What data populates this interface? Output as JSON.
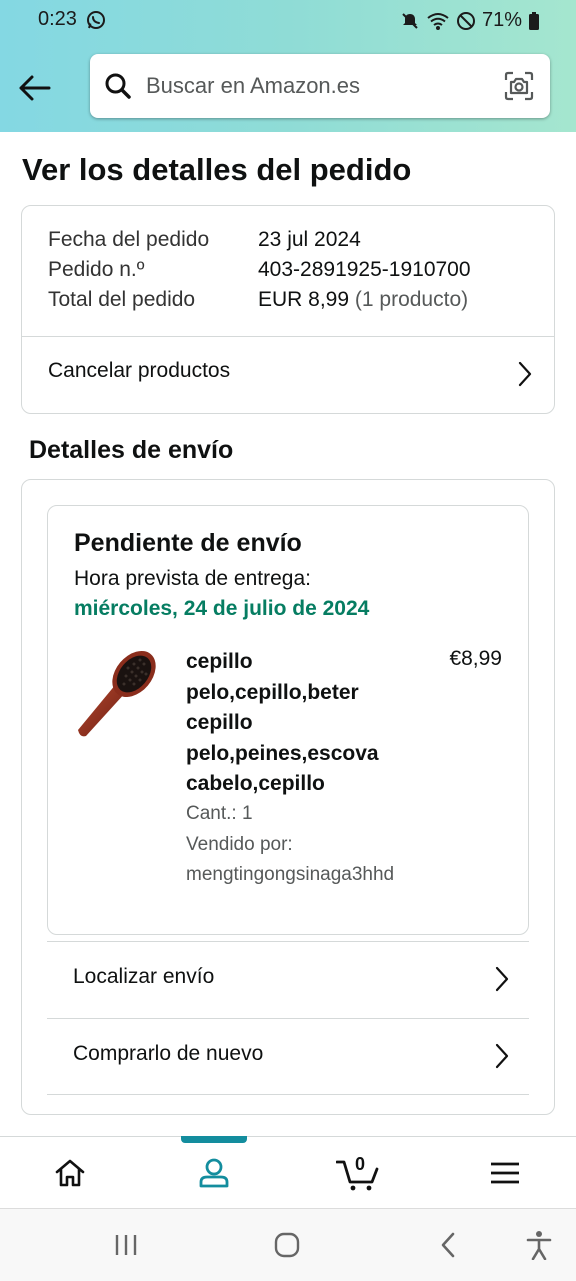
{
  "status_bar": {
    "time": "0:23",
    "battery": "71%",
    "icons": [
      "whatsapp-icon",
      "mute-icon",
      "wifi-icon",
      "do-not-disturb-icon",
      "battery-icon"
    ]
  },
  "header": {
    "search_placeholder": "Buscar en Amazon.es",
    "icons": [
      "back-arrow-icon",
      "search-icon",
      "camera-icon"
    ]
  },
  "page_title": "Ver los detalles del pedido",
  "order_summary": {
    "rows": [
      {
        "label": "Fecha del pedido",
        "value": "23 jul 2024"
      },
      {
        "label": "Pedido n.º",
        "value": "403-2891925-1910700"
      },
      {
        "label": "Total del pedido",
        "value": "EUR 8,99",
        "sub": "(1 producto)"
      }
    ],
    "cancel_label": "Cancelar productos"
  },
  "shipping": {
    "section_title": "Detalles de envío",
    "status": "Pendiente de envío",
    "eta_label": "Hora prevista de entrega:",
    "eta_date": "miércoles, 24 de julio de 2024",
    "product": {
      "name": "cepillo pelo,cepillo,beter cepillo pelo,peines,escova cabelo,cepillo",
      "price": "€8,99",
      "qty": "Cant.: 1",
      "sold_by_label": "Vendido por:",
      "seller": "mengtingongsinaga3hhd"
    },
    "actions": [
      {
        "label": "Localizar envío"
      },
      {
        "label": "Comprarlo de nuevo"
      }
    ]
  },
  "bottom_nav": {
    "items": [
      "home-icon",
      "account-icon",
      "cart-icon",
      "menu-icon"
    ],
    "active": "account-icon",
    "cart_count": "0",
    "accent_color": "#138d9e"
  },
  "system_nav": [
    "recent-apps-icon",
    "home-button-icon",
    "back-icon",
    "accessibility-icon"
  ],
  "colors": {
    "header_gradient_start": "#84d8e3",
    "header_gradient_end": "#a5e6cf",
    "delivery_green": "#067d62",
    "border": "#d5d9d9"
  }
}
